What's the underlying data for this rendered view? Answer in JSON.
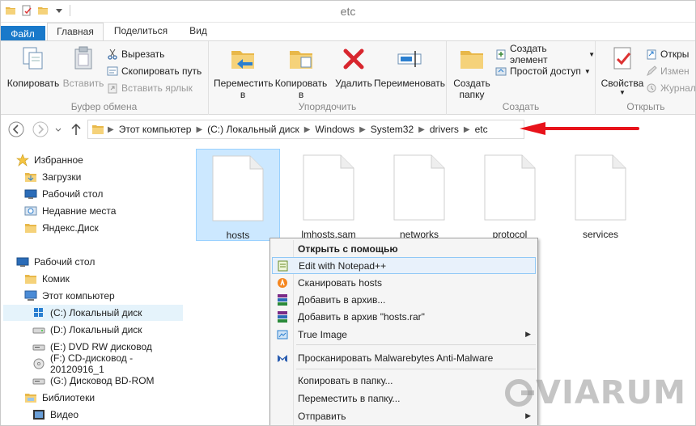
{
  "window": {
    "title": "etc"
  },
  "tabs": {
    "file": "Файл",
    "home": "Главная",
    "share": "Поделиться",
    "view": "Вид"
  },
  "ribbon": {
    "clipboard": {
      "label": "Буфер обмена",
      "copy": "Копировать",
      "paste": "Вставить",
      "cut": "Вырезать",
      "copy_path": "Скопировать путь",
      "paste_shortcut": "Вставить ярлык"
    },
    "organize": {
      "label": "Упорядочить",
      "move_to_1": "Переместить",
      "move_to_2": "в",
      "copy_to_1": "Копировать",
      "copy_to_2": "в",
      "delete": "Удалить",
      "rename": "Переименовать"
    },
    "create": {
      "label": "Создать",
      "new_folder_1": "Создать",
      "new_folder_2": "папку",
      "new_item": "Создать элемент",
      "easy_access": "Простой доступ"
    },
    "open": {
      "label": "Открыть",
      "properties": "Свойства",
      "open": "Откры",
      "edit": "Измен",
      "history": "Журнал"
    }
  },
  "address": {
    "crumbs": [
      "Этот компьютер",
      "(C:) Локальный диск",
      "Windows",
      "System32",
      "drivers",
      "etc"
    ]
  },
  "navpane": {
    "favorites": "Избранное",
    "downloads": "Загрузки",
    "desktop": "Рабочий стол",
    "recent": "Недавние места",
    "yandex": "Яндекс.Диск",
    "desktop_root": "Рабочий стол",
    "komik": "Комик",
    "this_pc": "Этот компьютер",
    "drive_c": "(C:) Локальный диск",
    "drive_d": "(D:) Локальный диск",
    "drive_e": "(E:) DVD RW дисковод",
    "drive_f": "(F:) CD-дисковод - 20120916_1",
    "drive_g": "(G:) Дисковод BD-ROM",
    "libraries": "Библиотеки",
    "video": "Видео"
  },
  "files": [
    "hosts",
    "lmhosts.sam",
    "networks",
    "protocol",
    "services"
  ],
  "context_menu": {
    "open_with": "Открыть с помощью",
    "notepadpp": "Edit with Notepad++",
    "scan": "Сканировать hosts",
    "add_archive": "Добавить в архив...",
    "add_rar": "Добавить в архив \"hosts.rar\"",
    "true_image": "True Image",
    "malwarebytes": "Просканировать Malwarebytes Anti-Malware",
    "copy_to": "Копировать в папку...",
    "move_to": "Переместить в папку...",
    "send_to": "Отправить"
  },
  "watermark": "VIARUM",
  "colors": {
    "accent": "#1979ca",
    "selection": "#cce8ff",
    "arrow": "#e8131b"
  }
}
